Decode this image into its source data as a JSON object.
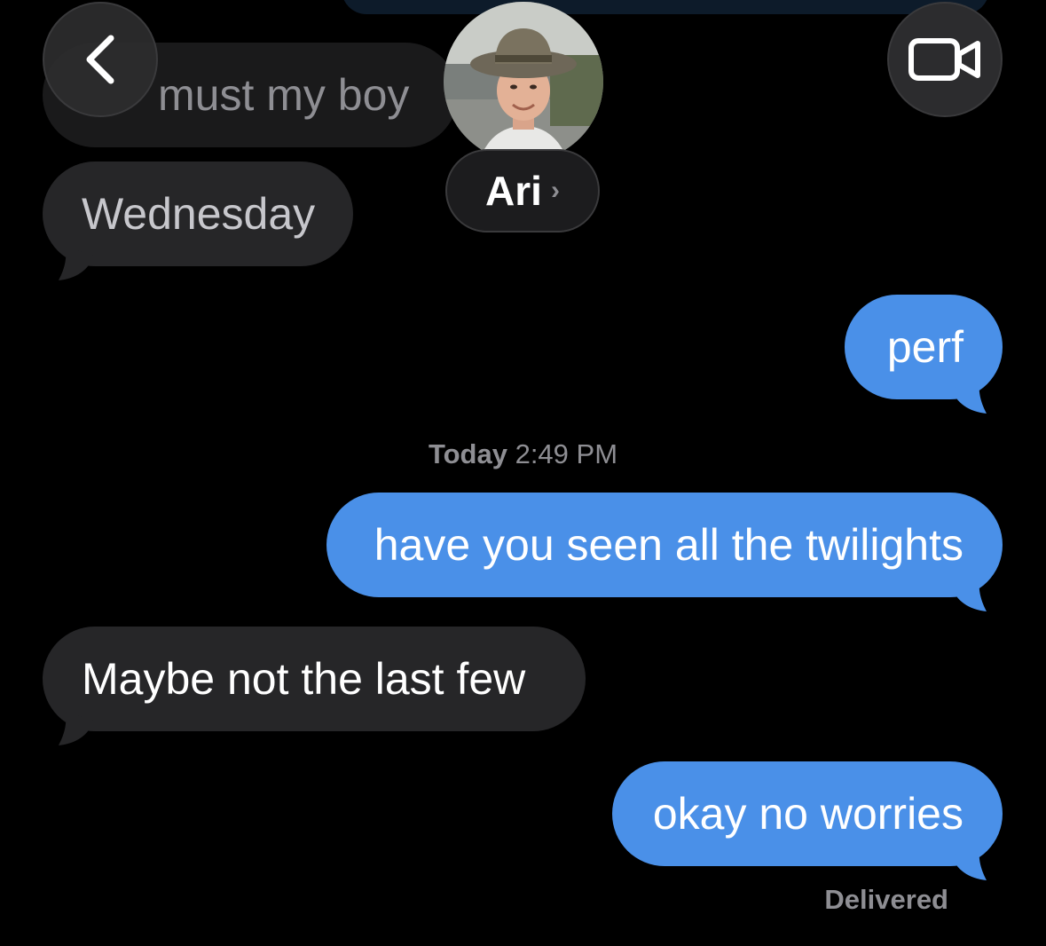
{
  "header": {
    "back_icon": "chevron-left-icon",
    "video_icon": "video-camera-icon",
    "contact_name": "Ari",
    "contact_chevron": "›"
  },
  "messages": [
    {
      "direction": "in",
      "text": "must my boy",
      "state": "faded"
    },
    {
      "direction": "in",
      "text": "Wednesday"
    },
    {
      "direction": "out",
      "text": "perf"
    },
    {
      "direction": "out",
      "text": "have you seen all the twilights"
    },
    {
      "direction": "in",
      "text": "Maybe not the last few"
    },
    {
      "direction": "out",
      "text": "okay no worries"
    }
  ],
  "timestamp": {
    "day": "Today",
    "time": "2:49 PM"
  },
  "status": "Delivered",
  "colors": {
    "background": "#000000",
    "incoming_bubble": "#262628",
    "outgoing_bubble": "#4A90E8",
    "secondary_text": "#8e8e93"
  }
}
